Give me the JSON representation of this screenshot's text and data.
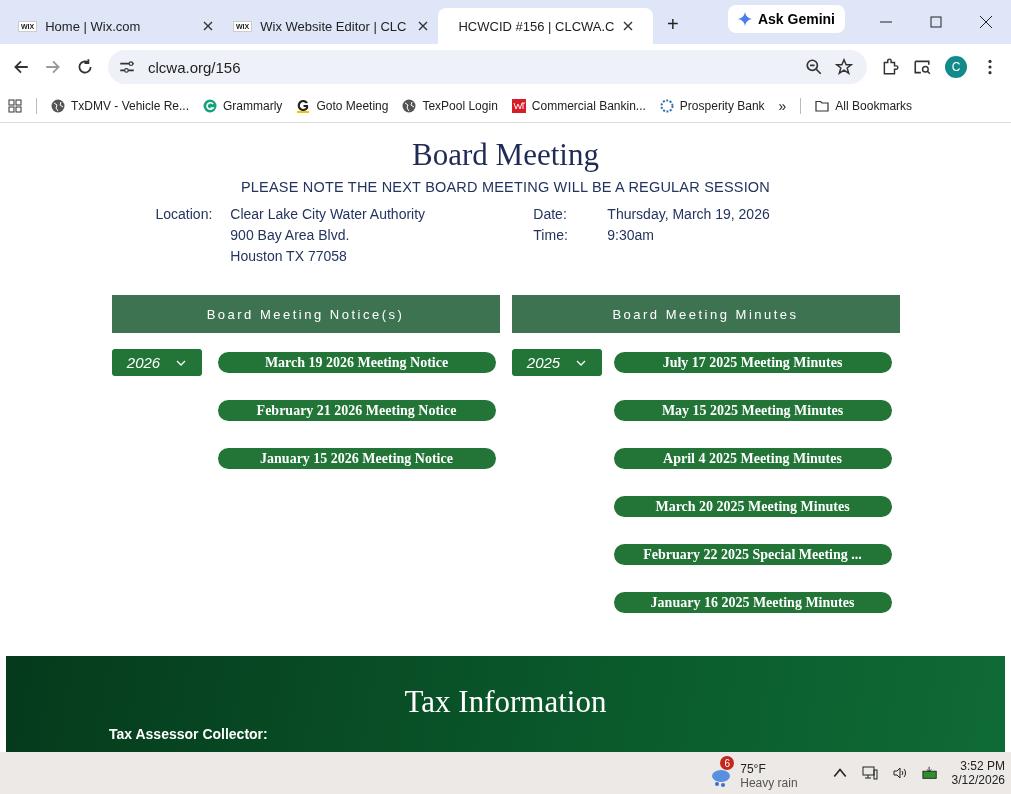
{
  "tabs": [
    {
      "label": "Home | Wix.com",
      "selected": false,
      "icon": "WIX"
    },
    {
      "label": "Wix Website Editor | CLC",
      "selected": false,
      "icon": "WIX"
    },
    {
      "label": "HCWCID #156 | CLCWA.C",
      "selected": true
    }
  ],
  "new_tab": "+",
  "gemini": "Ask Gemini",
  "address": "clcwa.org/156",
  "profile": "C",
  "bookmarks": [
    {
      "label": "TxDMV - Vehicle Re...",
      "kind": "globe"
    },
    {
      "label": "Grammarly",
      "kind": "grammarly"
    },
    {
      "label": "Goto Meeting",
      "kind": "goto"
    },
    {
      "label": "TexPool Login",
      "kind": "globe"
    },
    {
      "label": "Commercial Bankin...",
      "kind": "wf"
    },
    {
      "label": "Prosperity Bank",
      "kind": "ring"
    }
  ],
  "bookmarks_more": "»",
  "all_bookmarks": "All Bookmarks",
  "page": {
    "title": "Board Meeting",
    "notice": "PLEASE NOTE THE NEXT BOARD MEETING WILL BE A REGULAR SESSION",
    "location_label": "Location:",
    "location_lines": [
      "Clear Lake City Water Authority",
      "900 Bay Area Blvd.",
      "Houston TX 77058"
    ],
    "date_label": "Date:",
    "date": "Thursday, March 19, 2026",
    "time_label": "Time:",
    "time": "9:30am",
    "columns": [
      {
        "heading": "Board Meeting Notice(s)",
        "year": "2026",
        "links": [
          "March 19 2026 Meeting Notice",
          "February 21 2026 Meeting Notice",
          "January 15 2026 Meeting Notice"
        ]
      },
      {
        "heading": "Board Meeting Minutes",
        "year": "2025",
        "links": [
          "July 17 2025 Meeting Minutes",
          "May 15 2025 Meeting Minutes",
          "April 4 2025 Meeting Minutes",
          "March 20 2025 Meeting Minutes",
          "February 22 2025 Special Meeting ...",
          "January 16 2025 Meeting Minutes"
        ]
      }
    ],
    "tax_title": "Tax Information",
    "tax_label": "Tax Assessor Collector:"
  },
  "taskbar": {
    "weather_badge": "6",
    "temperature": "75°F",
    "weather": "Heavy rain",
    "time": "3:52 PM",
    "date": "3/12/2026"
  }
}
